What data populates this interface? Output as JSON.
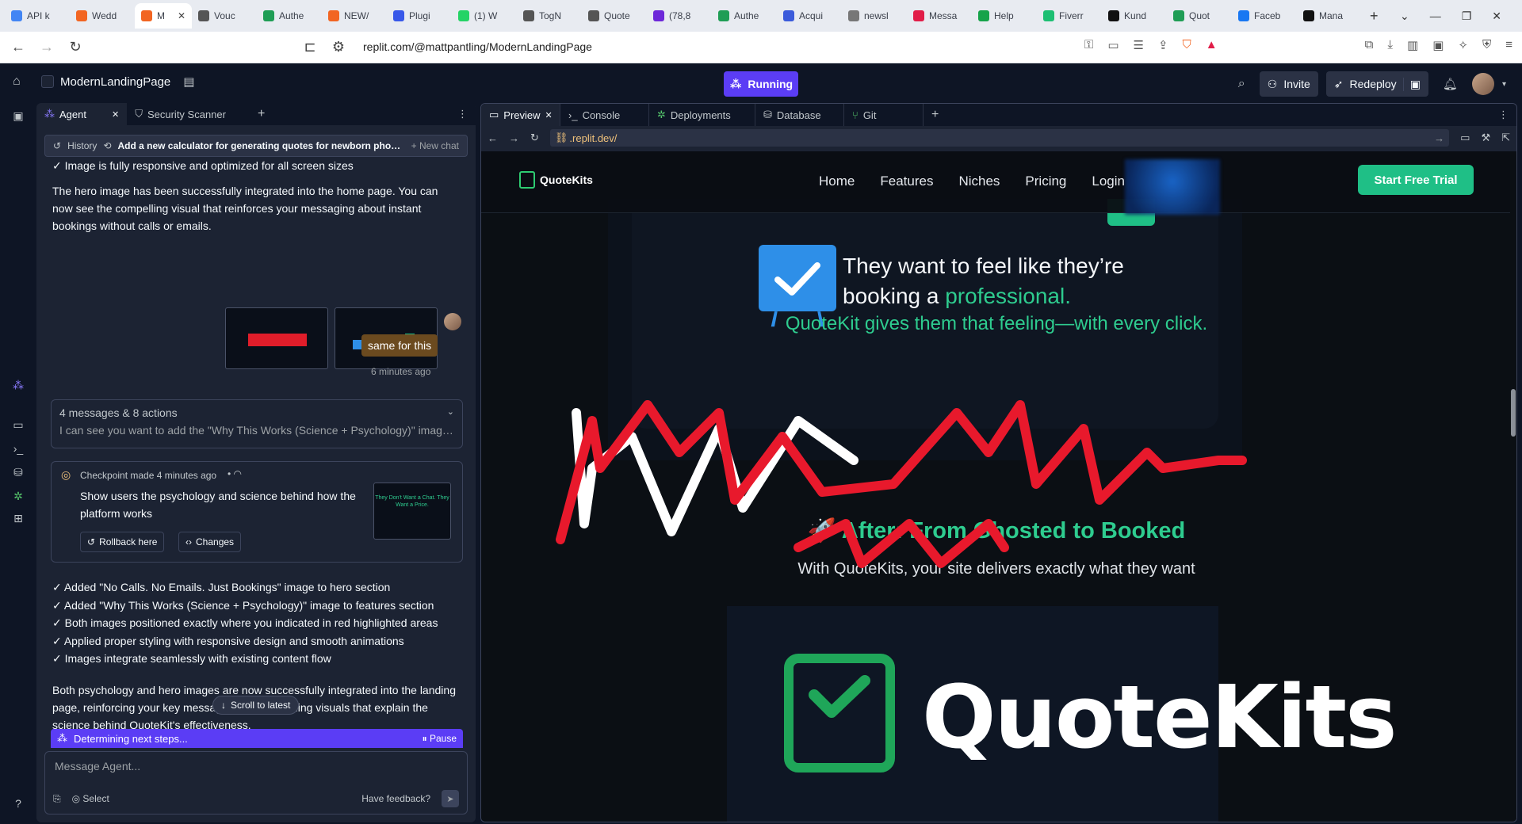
{
  "browser": {
    "tabs": [
      {
        "label": "API k",
        "color": "#4285f4"
      },
      {
        "label": "Wedd",
        "color": "#f26522"
      },
      {
        "label": "M",
        "color": "#f26522",
        "active": true
      },
      {
        "label": "Vouc",
        "color": "#555555"
      },
      {
        "label": "Authe",
        "color": "#1f9d55"
      },
      {
        "label": "NEW/",
        "color": "#f26522"
      },
      {
        "label": "Plugi",
        "color": "#3858e9"
      },
      {
        "label": "(1) W",
        "color": "#25d366"
      },
      {
        "label": "TogN",
        "color": "#555555"
      },
      {
        "label": "Quote",
        "color": "#555555"
      },
      {
        "label": "(78,8",
        "color": "#6d28d9"
      },
      {
        "label": "Authe",
        "color": "#1f9d55"
      },
      {
        "label": "Acqui",
        "color": "#3b5bdb"
      },
      {
        "label": "newsl",
        "color": "#777777"
      },
      {
        "label": "Messa",
        "color": "#e11d48"
      },
      {
        "label": "Help",
        "color": "#16a34a"
      },
      {
        "label": "Fiverr",
        "color": "#1dbf73"
      },
      {
        "label": "Kund",
        "color": "#111111"
      },
      {
        "label": "Quot",
        "color": "#1f9d55"
      },
      {
        "label": "Faceb",
        "color": "#1877f2"
      },
      {
        "label": "Mana",
        "color": "#111111"
      }
    ],
    "url": "replit.com/@mattpantling/ModernLandingPage"
  },
  "replit": {
    "project_name": "ModernLandingPage",
    "status": "Running",
    "invite_label": "Invite",
    "redeploy_label": "Redeploy"
  },
  "agent_panel": {
    "tabs": [
      "Agent",
      "Security Scanner"
    ],
    "history_label": "History",
    "chat_title": "Add a new calculator for generating quotes for newborn photo...",
    "new_chat_label": "New chat",
    "line_top": "✓ Image is fully responsive and optimized for all screen sizes",
    "para1": "The hero image has been successfully integrated into the home page. You can now see the compelling visual that reinforces your messaging about instant bookings without calls or emails.",
    "user_message": "same for this",
    "user_time": "6 minutes ago",
    "collapsed_title": "4 messages & 8 actions",
    "collapsed_preview": "I can see you want to add the \"Why This Works (Science + Psychology)\" image...",
    "checkpoint_label": "Checkpoint made 4 minutes ago",
    "checkpoint_desc": "Show users the psychology and science behind how the platform works",
    "rollback_label": "Rollback here",
    "changes_label": "Changes",
    "checkpoint_thumb_text": "They Don't Want a Chat. They Want a Price.",
    "summary_items": [
      "✓ Added \"No Calls. No Emails. Just Bookings\" image to hero section",
      "✓ Added \"Why This Works (Science + Psychology)\" image to features section",
      "✓ Both images positioned exactly where you indicated in red highlighted areas",
      "✓ Applied proper styling with responsive design and smooth animations",
      "✓ Images integrate seamlessly with existing content flow"
    ],
    "para2": "Both psychology and hero images are now successfully integrated into the landing page, reinforcing your key messages with compelling visuals that explain the science behind QuoteKit's effectiveness.",
    "scroll_latest_label": "Scroll to latest",
    "working_label": "Determining next steps...",
    "pause_label": "Pause",
    "input_placeholder": "Message Agent...",
    "select_label": "Select",
    "feedback_label": "Have feedback?"
  },
  "right_panel": {
    "tabs": [
      "Preview",
      "Console",
      "Deployments",
      "Database",
      "Git"
    ],
    "dev_url": ".replit.dev/"
  },
  "site": {
    "brand": "QuoteKits",
    "nav": [
      "Home",
      "Features",
      "Niches",
      "Pricing",
      "Login"
    ],
    "cta": "Start Free Trial",
    "headline_1": "They want to feel like they’re",
    "headline_2": "booking a ",
    "headline_green": "professional.",
    "subline": "QuoteKit gives them that feeling—with every click.",
    "after_heading": "🚀 After: From Ghosted to Booked",
    "after_sub": "With QuoteKits, your site delivers exactly what they want",
    "big_logo_text": "QuoteKits"
  },
  "colors": {
    "accent": "#5b3df5",
    "brand_green": "#2ecc8f",
    "cta_green": "#1fbf86",
    "scribble_red": "#e8192c"
  }
}
